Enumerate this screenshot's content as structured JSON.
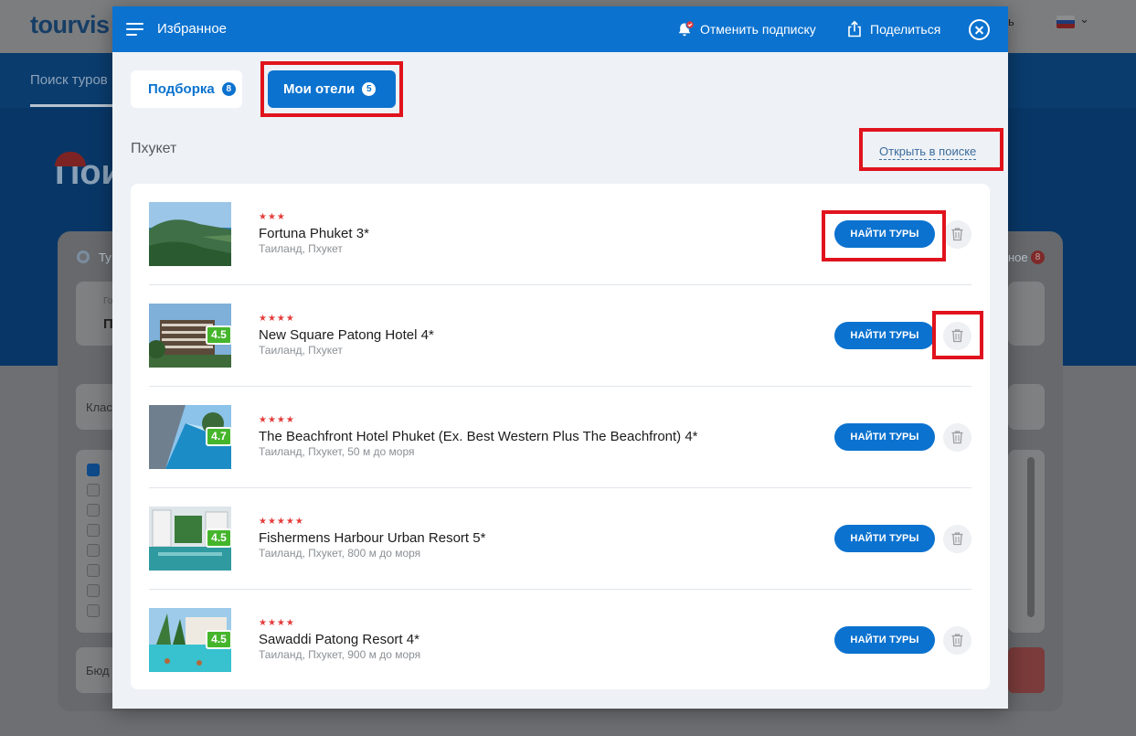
{
  "background": {
    "logo": "tourvis",
    "help_label": "ь",
    "nav_item": "Поиск туров",
    "hero_title": "Пои",
    "tour_radio_label": "Ту",
    "field_label": "Го",
    "field_value": "П",
    "class_label": "Клас",
    "favorites_label": "ное",
    "favorites_count": "8",
    "budget_label": "Бюд"
  },
  "modal": {
    "title": "Избранное",
    "unsubscribe_label": "Отменить подписку",
    "share_label": "Поделиться",
    "tabs": [
      {
        "label": "Подборка",
        "count": "8",
        "selected": false
      },
      {
        "label": "Мои отели",
        "count": "5",
        "selected": true
      }
    ],
    "section_title": "Пхукет",
    "open_in_search_label": "Открыть в поиске",
    "find_tours_label": "НАЙТИ ТУРЫ",
    "hotels": [
      {
        "name": "Fortuna Phuket 3*",
        "stars": "★★★",
        "location": "Таиланд, Пхукет",
        "rating": ""
      },
      {
        "name": "New Square Patong Hotel 4*",
        "stars": "★★★★",
        "location": "Таиланд, Пхукет",
        "rating": "4.5"
      },
      {
        "name": "The Beachfront Hotel Phuket (Ex. Best Western Plus The Beachfront) 4*",
        "stars": "★★★★",
        "location": "Таиланд, Пхукет, 50 м до моря",
        "rating": "4.7"
      },
      {
        "name": "Fishermens Harbour Urban Resort 5*",
        "stars": "★★★★★",
        "location": "Таиланд, Пхукет, 800 м до моря",
        "rating": "4.5"
      },
      {
        "name": "Sawaddi Patong Resort 4*",
        "stars": "★★★★",
        "location": "Таиланд, Пхукет, 900 м до моря",
        "rating": "4.5"
      }
    ]
  },
  "colors": {
    "primary": "#0b72cf",
    "highlight": "#e0131d",
    "rating_green": "#45b52c",
    "star_red": "#e53c3c"
  }
}
